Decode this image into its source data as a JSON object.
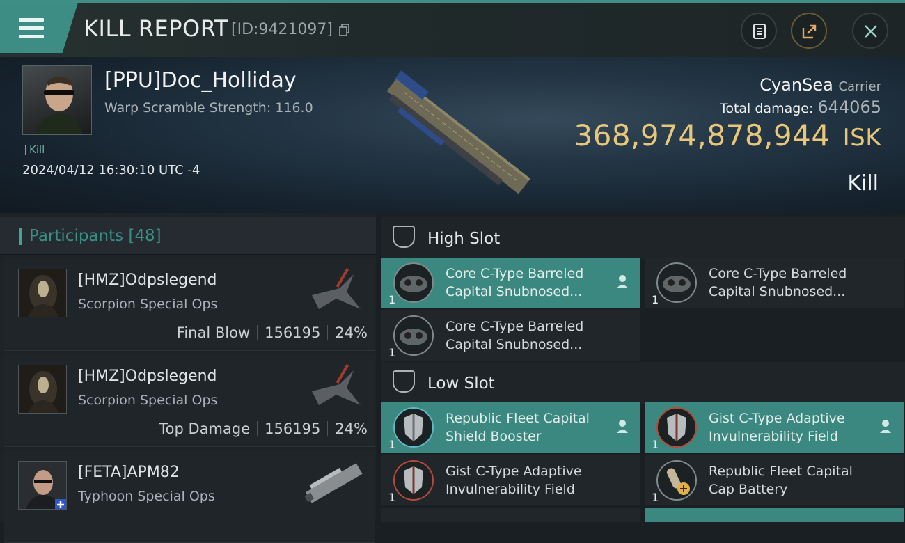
{
  "header": {
    "title": "KILL REPORT",
    "report_id": "[ID:9421097]",
    "colors": {
      "accent": "#3d8d84",
      "isk": "#e9c77a"
    }
  },
  "victim": {
    "pilot_name": "[PPU]Doc_Holliday",
    "warp_scramble": "Warp Scramble Strength: 116.0",
    "kill_tag": "Kill",
    "datetime": "2024/04/12 16:30:10 UTC -4",
    "ship_name": "CyanSea",
    "ship_class": "Carrier",
    "total_damage_label": "Total damage:",
    "total_damage_value": "644065",
    "isk_value": "368,974,878,944",
    "isk_unit": "ISK",
    "result": "Kill"
  },
  "participants": {
    "label": "Participants",
    "count": "[48]",
    "rows": [
      {
        "name": "[HMZ]Odpslegend",
        "ship": "Scorpion Special Ops",
        "role": "Final Blow",
        "damage": "156195",
        "percent": "24%"
      },
      {
        "name": "[HMZ]Odpslegend",
        "ship": "Scorpion Special Ops",
        "role": "Top Damage",
        "damage": "156195",
        "percent": "24%"
      },
      {
        "name": "[FETA]APM82",
        "ship": "Typhoon Special Ops",
        "role": "",
        "damage": "",
        "percent": ""
      }
    ]
  },
  "slots": {
    "high": {
      "label": "High Slot",
      "modules": [
        {
          "name": "Core C-Type Barreled Capital Snubnosed...",
          "qty": "1",
          "highlighted": true,
          "action": "person-icon"
        },
        {
          "name": "Core C-Type Barreled Capital Snubnosed...",
          "qty": "1",
          "highlighted": false,
          "action": "close-icon"
        },
        {
          "name": "Core C-Type Barreled Capital Snubnosed...",
          "qty": "1",
          "highlighted": false,
          "action": "close-icon"
        }
      ]
    },
    "low": {
      "label": "Low Slot",
      "modules": [
        {
          "name": "Republic Fleet Capital Shield Booster",
          "qty": "1",
          "highlighted": true,
          "action": "person-icon"
        },
        {
          "name": "Gist C-Type Adaptive Invulnerability Field",
          "qty": "1",
          "highlighted": true,
          "action": "person-icon"
        },
        {
          "name": "Gist C-Type Adaptive Invulnerability Field",
          "qty": "1",
          "highlighted": false,
          "action": "close-icon"
        },
        {
          "name": "Republic Fleet Capital Cap Battery",
          "qty": "1",
          "highlighted": false,
          "action": "close-icon"
        }
      ]
    }
  }
}
